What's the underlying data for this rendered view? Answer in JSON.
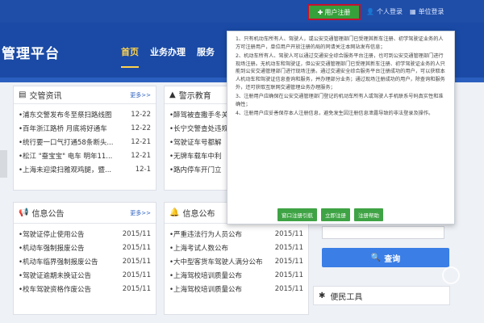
{
  "topbar": {
    "register_label": "用户注册",
    "personal_login": "个人登录",
    "unit_login": "单位登录"
  },
  "header": {
    "brand": "管理平台",
    "nav": [
      "首页",
      "业务办理",
      "服务"
    ]
  },
  "news": {
    "title": "交管资讯",
    "more": "更多>>",
    "items": [
      {
        "title": "•浦东交警发布冬至祭扫路线图",
        "date": "12-22"
      },
      {
        "title": "•百年浙江路桥 月底将好通车",
        "date": "12-22"
      },
      {
        "title": "•统行要一口气打通58条断头...",
        "date": "12-21"
      },
      {
        "title": "•松江 \"蚕宝宝\" 电车 明年11...",
        "date": "12-21"
      },
      {
        "title": "•上海未迎梁扫雅观鸡腿，暨...",
        "date": "12-1"
      }
    ]
  },
  "warning": {
    "title": "警示教育",
    "items": [
      "•醉驾被查撒手冬关",
      "•长宁交警查处违规",
      "•驾驶证车号都解",
      "•无牌车载车中利",
      "•路内停车开门立"
    ]
  },
  "notice": {
    "title": "信息公告",
    "more": "更多>>",
    "items": [
      {
        "title": "•驾驶证停止使用公告",
        "date": "2015/11"
      },
      {
        "title": "•机动车强制报废公告",
        "date": "2015/11"
      },
      {
        "title": "•机动车临界强制报废公告",
        "date": "2015/11"
      },
      {
        "title": "•驾驶证逾期未换证公告",
        "date": "2015/11"
      },
      {
        "title": "•校车驾驶资格作废公告",
        "date": "2015/11"
      }
    ]
  },
  "publish": {
    "title": "信息公布",
    "items": [
      {
        "title": "•严重违法行为人员公布",
        "date": "2015/11"
      },
      {
        "title": "•上海考试人数公布",
        "date": "2015/11"
      },
      {
        "title": "•大中型客货车驾驶人满分公布",
        "date": "2015/11"
      },
      {
        "title": "•上海驾校培训质量公布",
        "date": "2015/11"
      },
      {
        "title": "•上海驾校培训质量公布",
        "date": "2015/11"
      }
    ]
  },
  "popup": {
    "paragraphs": [
      "1、只有机动车所有人、驾驶人，或公安交通管理部门已受理其新车注册、初学驾驶证业务的人方可注册用户，单位用户开放注册的局的同请关注本网站发布信息；",
      "2、机动车所有人、驾驶人可以通过交通安全综合服务平台注册，也可到公安交通管理部门进行现场注册。无机动车和驾驶证，但公安交通管理部门已受理其新车注册、初学驾驶证业务的人只能到公安交通管理部门进行现场注册。通过交通安全综合服务平台注册成功的用户，可以获取本人机动车和驾驶证信息查询和服务，并办理部分业务；通过现场注册成功的用户，除查询和服务外，还可获取互联网交通管理业务办理服务；",
      "3、注册用户应确保在公安交通管理部门登记的机动车所有人或驾驶人手机联系号码真实性和准确性；",
      "4、注册用户应妥善保存本人注册信息，避免发生因注册信息泄露导致的非法登录及操作。"
    ],
    "buttons": [
      "窗口注册引航",
      "立即注册",
      "注册帮助"
    ]
  },
  "query_label": "查询",
  "tools_title": "便民工具"
}
